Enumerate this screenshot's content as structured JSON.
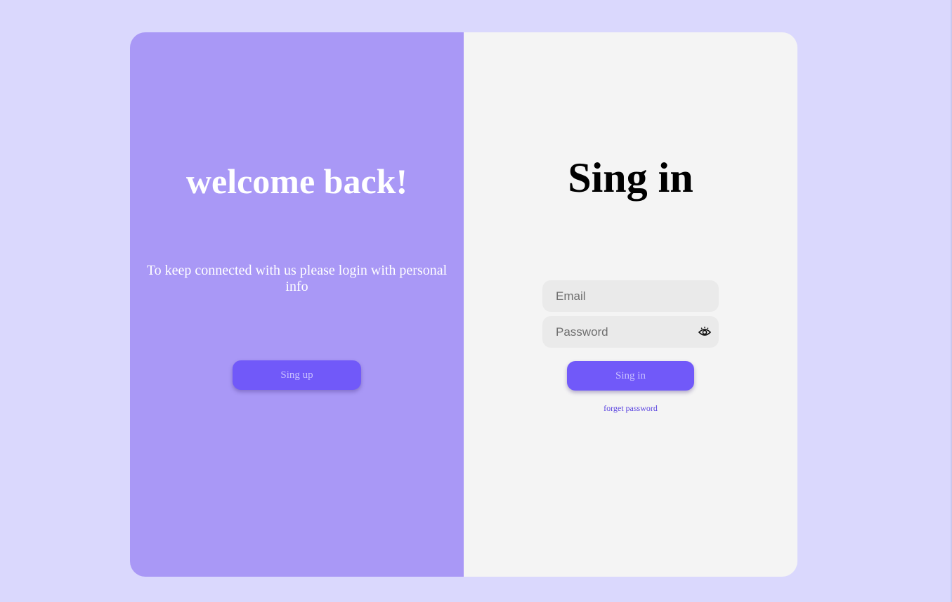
{
  "colors": {
    "page_background": "#dad8fd",
    "left_panel": "#a998f6",
    "right_panel": "#f4f4f4",
    "button": "#7159f9",
    "button_text": "#c9c0ff",
    "link": "#5a44e0"
  },
  "welcome": {
    "title": "welcome back!",
    "message": "To keep connected with us please login with personal info",
    "signup_label": "Sing up"
  },
  "signin": {
    "title": "Sing in",
    "email_placeholder": "Email",
    "password_placeholder": "Password",
    "password_toggle_icon": "eye-icon",
    "submit_label": "Sing in",
    "forget_label": "forget password"
  }
}
